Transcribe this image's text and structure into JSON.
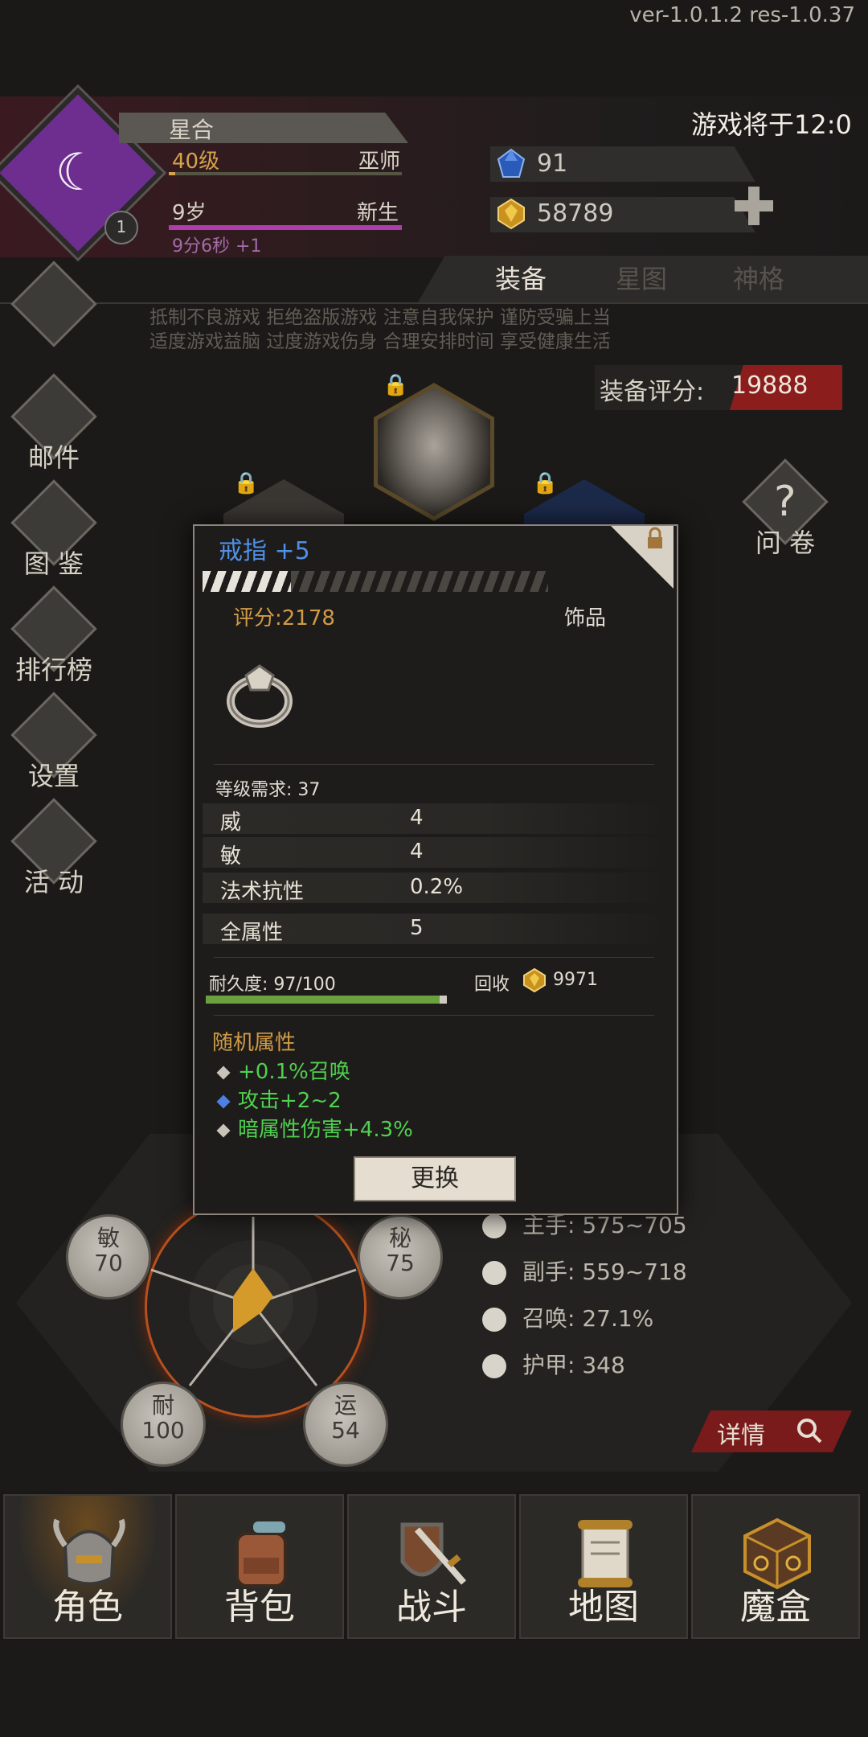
{
  "version": "ver-1.0.1.2  res-1.0.37",
  "notice": "游戏将于12:0",
  "player": {
    "name": "星合",
    "level": "40级",
    "class": "巫师",
    "age": "9岁",
    "stage": "新生",
    "timer": "9分6秒 +1",
    "rank": "1"
  },
  "resources": {
    "gems": "91",
    "gold": "58789"
  },
  "tabs": [
    "装备",
    "星图",
    "神格"
  ],
  "warning": {
    "line1": "抵制不良游戏 拒绝盗版游戏 注意自我保护 谨防受骗上当",
    "line2": "适度游戏益脑 过度游戏伤身 合理安排时间 享受健康生活"
  },
  "equip_score": {
    "label": "装备评分:",
    "value": "19888"
  },
  "side_menu": [
    "邮件",
    "图 鉴",
    "排行榜",
    "设置",
    "活 动"
  ],
  "questionnaire": "问 卷",
  "item": {
    "name": "戒指 +5",
    "score": "评分:2178",
    "type": "饰品",
    "requirement": "等级需求: 37",
    "attributes": [
      {
        "name": "威",
        "value": "4"
      },
      {
        "name": "敏",
        "value": "4"
      },
      {
        "name": "法术抗性",
        "value": "0.2%"
      },
      {
        "name": "全属性",
        "value": "5"
      }
    ],
    "durability_label": "耐久度: 97/100",
    "durability": 0.97,
    "recycle_label": "回收",
    "recycle_value": "9971",
    "random_title": "随机属性",
    "random_attrs": [
      "+0.1%召唤",
      "攻击+2~2",
      "暗属性伤害+4.3%"
    ],
    "change_button": "更换"
  },
  "stats": [
    {
      "name": "敏",
      "value": "70"
    },
    {
      "name": "秘",
      "value": "75"
    },
    {
      "name": "耐",
      "value": "100"
    },
    {
      "name": "运",
      "value": "54"
    }
  ],
  "combat": [
    {
      "icon": "sword-icon",
      "text": "主手: 575~705"
    },
    {
      "icon": "dagger-icon",
      "text": "副手: 559~718"
    },
    {
      "icon": "summon-icon",
      "text": "召唤: 27.1%"
    },
    {
      "icon": "armor-icon",
      "text": "护甲: 348"
    }
  ],
  "detail_button": "详情",
  "nav": [
    "角色",
    "背包",
    "战斗",
    "地图",
    "魔盒"
  ],
  "colors": {
    "accent_gold": "#d19b45",
    "item_blue": "#4f8fe6",
    "random_green": "#4fd04f",
    "danger_red": "#8b1d1d"
  }
}
